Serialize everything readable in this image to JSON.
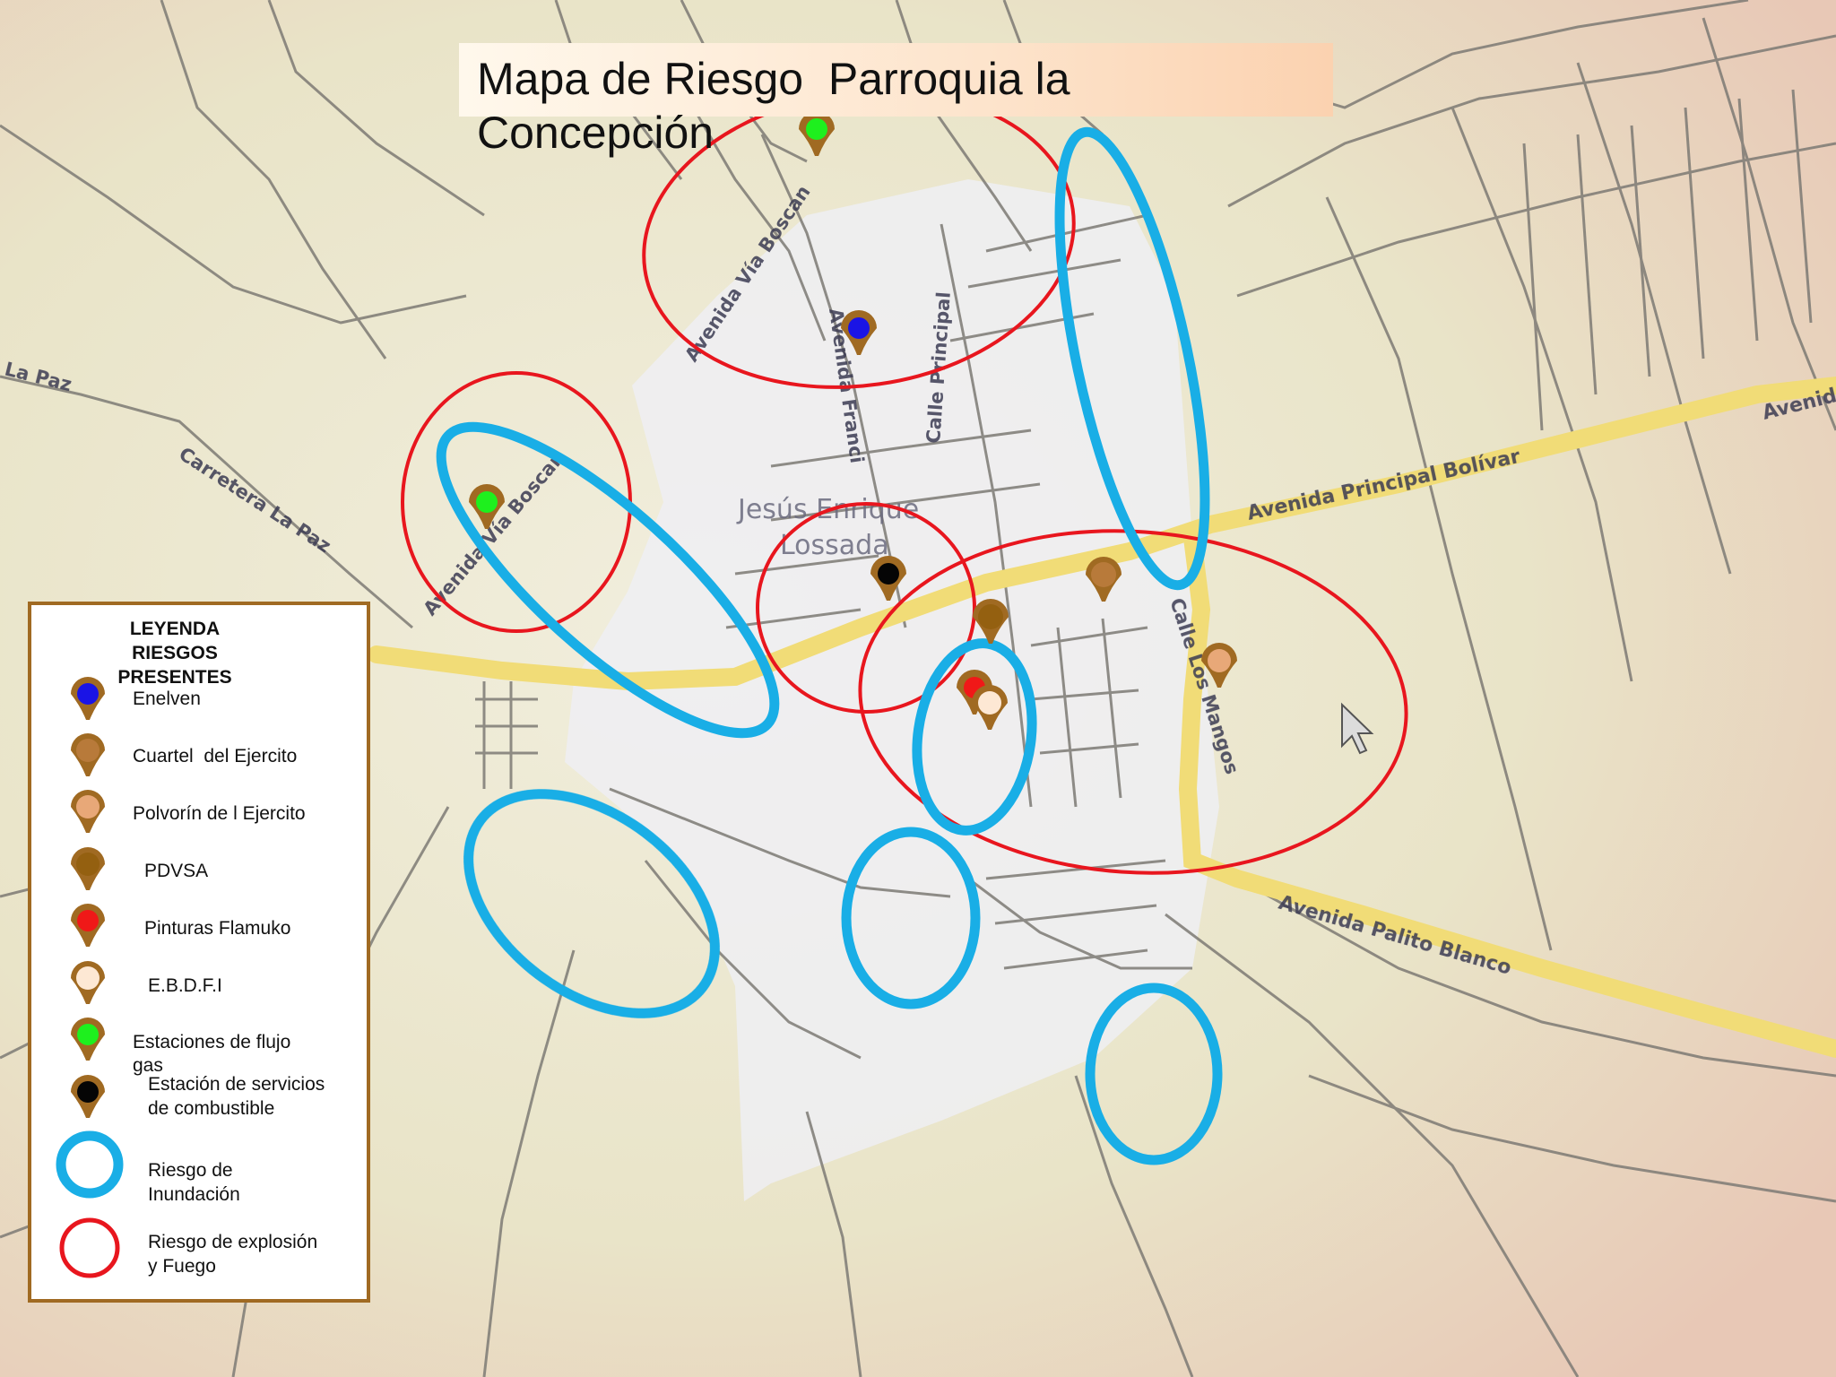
{
  "title": "Mapa de Riesgo  Parroquia la Concepción",
  "colors": {
    "map_background": "#ece8cf",
    "road": "#7d7a74",
    "highway": "#f1dc77",
    "urban": "#eeeef2",
    "explosion": "#e8161e",
    "flood": "#19aee6",
    "legend_border": "#a06a22"
  },
  "map_labels": {
    "via_boscan_top": "Avenida Vía Boscan",
    "via_boscan_left": "Avenida Vía Boscan",
    "av_francisco": "Avenida Franci",
    "calle_principal": "Calle Principal",
    "carretera_la_paz": "Carretera La Paz",
    "la_paz": "La Paz",
    "jesus_line1": "Jesús Enrique",
    "jesus_line2": "Lossada",
    "av_bolivar": "Avenida Principal Bolívar",
    "av_bolivar_end": "Avenida",
    "calle_los_mangos": "Calle Los Mangos",
    "av_palito_blanco": "Avenida Palito Blanco"
  },
  "legend": {
    "title": "LEYENDA\nRIESGOS\nPRESENTES",
    "items": [
      {
        "label": "Enelven",
        "icon": "pin",
        "color": "#1a14e6"
      },
      {
        "label": "Cuartel  del Ejercito",
        "icon": "pin",
        "color": "#b87a3a"
      },
      {
        "label": "Polvorín de l Ejercito",
        "icon": "pin",
        "color": "#e8a878"
      },
      {
        "label": "PDVSA",
        "icon": "pin",
        "color": "#946010"
      },
      {
        "label": "Pinturas Flamuko",
        "icon": "pin",
        "color": "#f01818"
      },
      {
        "label": "E.B.D.F.I",
        "icon": "pin",
        "color": "#fde8d4"
      },
      {
        "label": "Estaciones de flujo\ngas",
        "icon": "pin",
        "color": "#1ef01e"
      },
      {
        "label": "Estación de servicios\nde combustible",
        "icon": "pin",
        "color": "#050505"
      },
      {
        "label": "Riesgo de\nInundación",
        "icon": "ring",
        "color": "#19aee6"
      },
      {
        "label": "Riesgo de explosión\ny Fuego",
        "icon": "ring",
        "color": "#e8161e"
      }
    ]
  },
  "markers": [
    {
      "type": "Estaciones de flujo gas",
      "color": "#1ef01e"
    },
    {
      "type": "Enelven",
      "color": "#1a14e6"
    },
    {
      "type": "Estaciones de flujo gas",
      "color": "#1ef01e"
    },
    {
      "type": "Estación de servicios de combustible",
      "color": "#050505"
    },
    {
      "type": "Cuartel del Ejercito",
      "color": "#b87a3a"
    },
    {
      "type": "PDVSA",
      "color": "#946010"
    },
    {
      "type": "Polvorín de l Ejercito",
      "color": "#e8a878"
    },
    {
      "type": "Pinturas Flamuko",
      "color": "#f01818"
    },
    {
      "type": "E.B.D.F.I",
      "color": "#fde8d4"
    }
  ],
  "risk_zones": {
    "explosion_count": 4,
    "flood_count": 6
  }
}
